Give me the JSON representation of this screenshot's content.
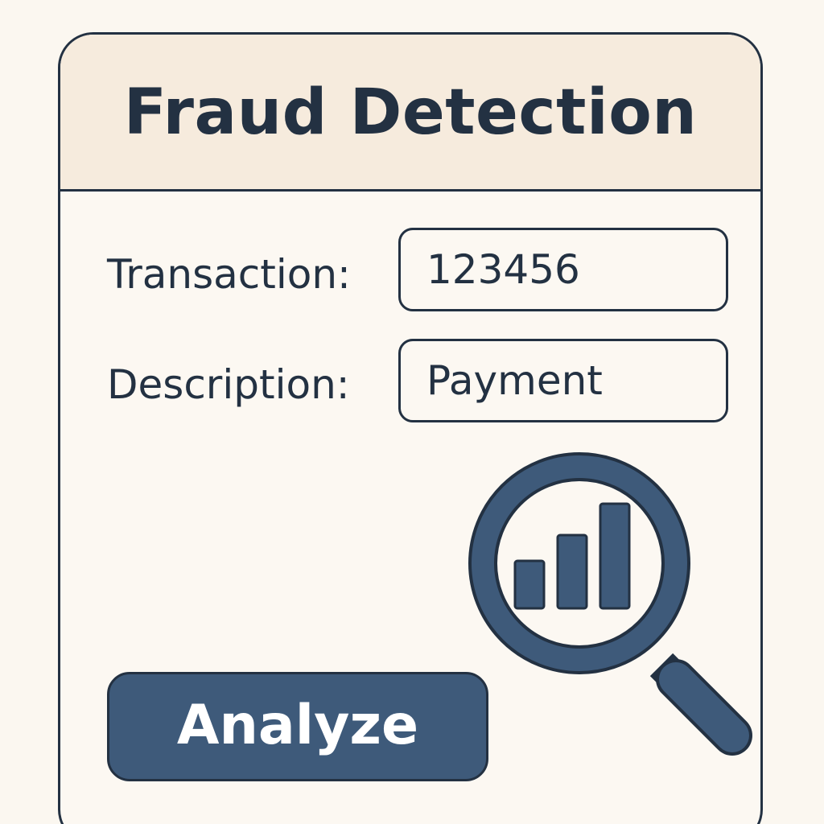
{
  "app": {
    "title": "Fraud Detection"
  },
  "form": {
    "transaction_label": "Transaction:",
    "transaction_value": "123456",
    "description_label": "Description:",
    "description_value": "Payment"
  },
  "actions": {
    "analyze_label": "Analyze"
  },
  "illustration": {
    "icon": "magnifier-bar-chart-icon",
    "bar_levels": [
      0.45,
      0.7,
      1.0
    ]
  },
  "colors": {
    "background": "#fbf7f0",
    "header": "#f6ebdd",
    "ink": "#233142",
    "accent": "#3e5a7a"
  }
}
